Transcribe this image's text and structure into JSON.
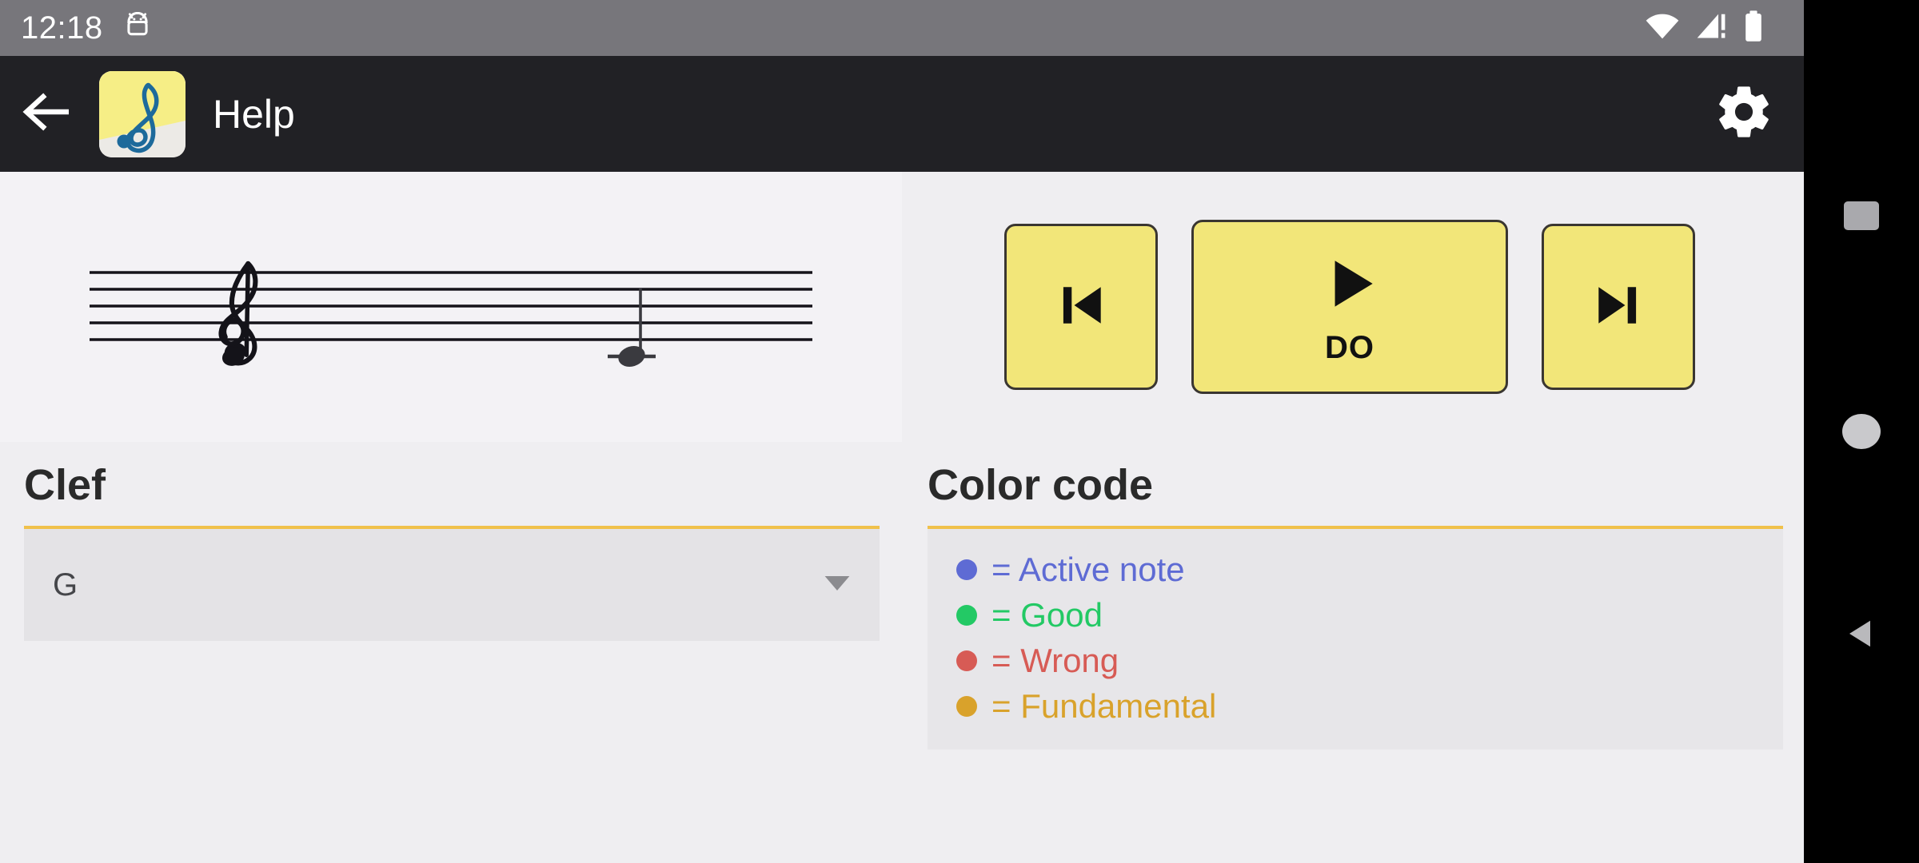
{
  "statusbar": {
    "clock": "12:18",
    "icons": [
      "debug-android-icon",
      "wifi-icon",
      "cellular-no-sim-icon",
      "battery-icon"
    ]
  },
  "appbar": {
    "back_icon": "back-arrow-icon",
    "app_icon": "treble-clef-app-icon",
    "title": "Help",
    "settings_icon": "gear-icon"
  },
  "staff": {
    "clef": "treble-clef",
    "note": {
      "name": "DO",
      "pitch": "middle-c",
      "ledger_line": true,
      "stem": "up",
      "color": "#3A3A3F"
    },
    "line_count": 5
  },
  "transport": {
    "prev_label": "",
    "prev_icon": "skip-previous-icon",
    "play_icon": "play-icon",
    "play_label": "DO",
    "next_label": "",
    "next_icon": "skip-next-icon",
    "button_color": "#F2E679",
    "border_color": "#3A3631"
  },
  "clef_section": {
    "title": "Clef",
    "selected": "G",
    "caret_icon": "chevron-down-icon",
    "accent": "#F0C14B"
  },
  "colorcode_section": {
    "title": "Color code",
    "accent": "#F0C14B",
    "items": [
      {
        "dot": "#5E6BD4",
        "text": "= Active note",
        "color": "#5E6BD4"
      },
      {
        "dot": "#23C965",
        "text": "= Good",
        "color": "#23C965"
      },
      {
        "dot": "#D75B55",
        "text": "= Wrong",
        "color": "#D75B55"
      },
      {
        "dot": "#D9A22B",
        "text": "= Fundamental",
        "color": "#D9A22B"
      }
    ]
  },
  "navbar": {
    "recents_icon": "square-recents-icon",
    "home_icon": "circle-home-icon",
    "back_icon": "triangle-back-icon"
  }
}
